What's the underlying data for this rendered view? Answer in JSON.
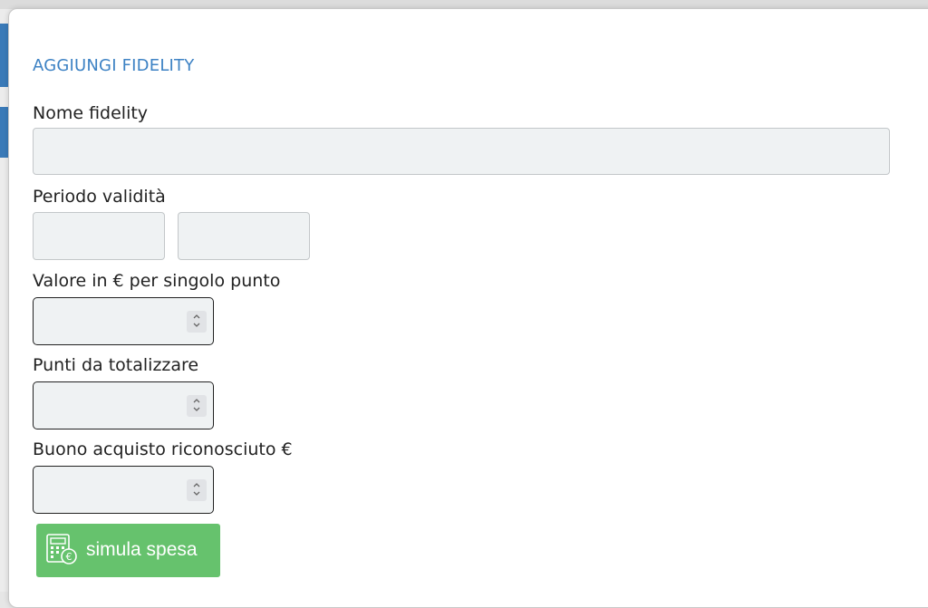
{
  "form": {
    "title": "AGGIUNGI FIDELITY",
    "name_label": "Nome fidelity",
    "name_value": "",
    "period_label": "Periodo validità",
    "period_start_value": "",
    "period_end_value": "",
    "point_value_label": "Valore in € per singolo punto",
    "point_value_value": "",
    "points_total_label": "Punti da totalizzare",
    "points_total_value": "",
    "voucher_label": "Buono acquisto riconosciuto €",
    "voucher_value": "",
    "simulate_button_label": "simula spesa"
  },
  "icons": {
    "simulate_button": "calculator-euro-icon",
    "spinner": "up-down-spinner-icon"
  },
  "colors": {
    "title": "#3d82c4",
    "button": "#66c26d",
    "field_bg": "#eff2f3",
    "bg_tab": "#3a7ab8"
  }
}
